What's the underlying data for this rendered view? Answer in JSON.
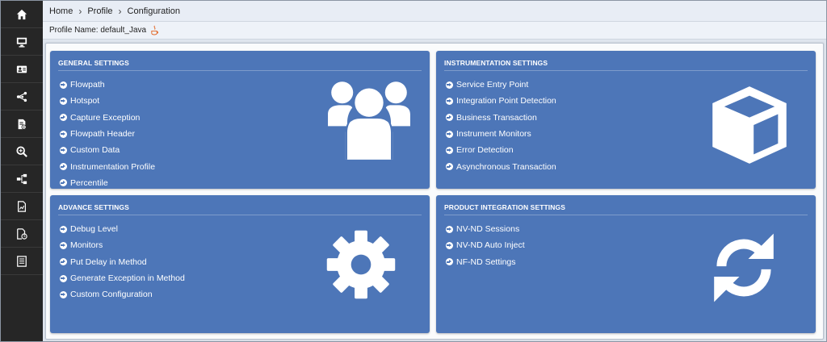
{
  "breadcrumb": [
    "Home",
    "Profile",
    "Configuration"
  ],
  "profile": {
    "label": "Profile Name: default_Java"
  },
  "sidebar": {
    "items": [
      {
        "icon": "home-icon"
      },
      {
        "icon": "monitor-icon"
      },
      {
        "icon": "id-card-icon"
      },
      {
        "icon": "network-icon"
      },
      {
        "icon": "file-settings-icon"
      },
      {
        "icon": "search-zoom-icon"
      },
      {
        "icon": "sitemap-icon"
      },
      {
        "icon": "report-icon"
      },
      {
        "icon": "file-clock-icon"
      },
      {
        "icon": "document-list-icon"
      }
    ]
  },
  "cards": {
    "general": {
      "title": "GENERAL SETTINGS",
      "icon": "users-group-icon",
      "items": [
        "Flowpath",
        "Hotspot",
        "Capture Exception",
        "Flowpath Header",
        "Custom Data",
        "Instrumentation Profile",
        "Percentile"
      ]
    },
    "instrumentation": {
      "title": "INSTRUMENTATION SETTINGS",
      "icon": "cube-icon",
      "items": [
        "Service Entry Point",
        "Integration Point Detection",
        "Business Transaction",
        "Instrument Monitors",
        "Error Detection",
        "Asynchronous Transaction"
      ]
    },
    "advance": {
      "title": "ADVANCE SETTINGS",
      "icon": "gear-icon",
      "items": [
        "Debug Level",
        "Monitors",
        "Put Delay in Method",
        "Generate Exception in Method",
        "Custom Configuration"
      ]
    },
    "product": {
      "title": "PRODUCT INTEGRATION SETTINGS",
      "icon": "sync-icon",
      "items": [
        "NV-ND Sessions",
        "NV-ND Auto Inject",
        "NF-ND Settings"
      ]
    }
  },
  "colors": {
    "card": "#4d76b8",
    "sidebar": "#262626",
    "text_on_card": "#ffffff"
  }
}
